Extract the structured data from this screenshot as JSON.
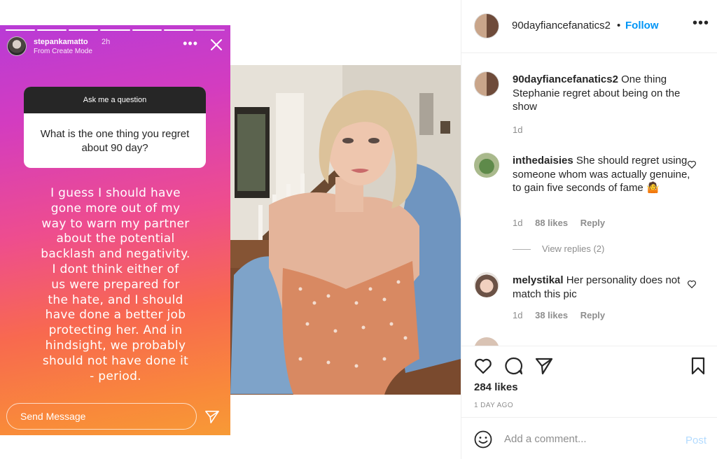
{
  "story": {
    "username": "stepankamatto",
    "time": "2h",
    "mode": "From Create Mode",
    "question_header": "Ask me a question",
    "question": "What is the one thing you regret about 90 day?",
    "answer_lines": [
      "I guess I should have",
      "gone more out of my",
      "way to warn my partner",
      "about the potential",
      "backlash and negativity.",
      "I dont think either of",
      "us were prepared for",
      "the hate, and I should",
      "have done a better job",
      "protecting her. And in",
      "hindsight, we probably",
      "should not have done it",
      "- period."
    ],
    "send_placeholder": "Send Message",
    "progress_segments": 7,
    "progress_done": 6
  },
  "post": {
    "author": "90dayfiancefanatics2",
    "dot": "•",
    "follow": "Follow",
    "caption_user": "90dayfiancefanatics2",
    "caption": "One thing Stephanie regret about being on the show",
    "caption_time": "1d",
    "comments": [
      {
        "user": "inthedaisies",
        "text": "She should regret using someone whom was actually genuine, to gain five seconds of fame 🤷",
        "time": "1d",
        "likes": "88 likes",
        "reply": "Reply",
        "view_replies": "View replies (2)"
      },
      {
        "user": "melystikal",
        "text": "Her personality does not match this pic",
        "time": "1d",
        "likes": "38 likes",
        "reply": "Reply"
      }
    ],
    "likes": "284 likes",
    "date": "1 DAY AGO",
    "add_comment_placeholder": "Add a comment...",
    "post_button": "Post"
  },
  "icons": {
    "close": "close-icon",
    "more": "more-dots-icon",
    "send": "paper-plane-icon",
    "like": "heart-icon",
    "comment": "comment-bubble-icon",
    "share": "paper-plane-icon",
    "save": "bookmark-icon",
    "emoji": "smiley-icon"
  },
  "colors": {
    "link_blue": "#0095f6",
    "post_disabled": "#b3dbff",
    "muted": "#8e8e8e"
  }
}
